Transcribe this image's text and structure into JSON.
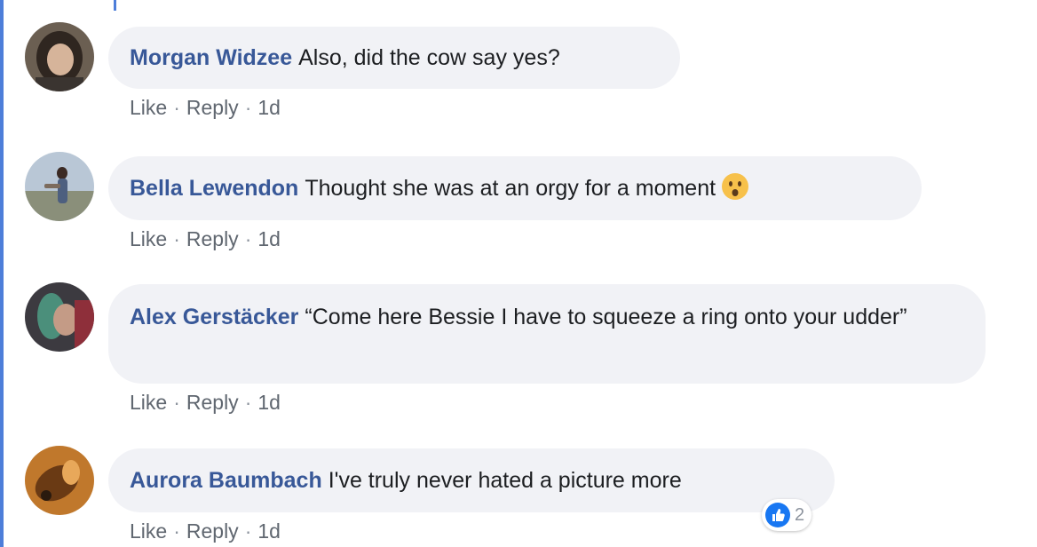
{
  "comments": [
    {
      "author": "Morgan Widzee",
      "text": "Also, did the cow say yes?",
      "actions": {
        "like": "Like",
        "reply": "Reply",
        "time": "1d"
      },
      "avatar_icon": "profile-photo-woman-dark-hair"
    },
    {
      "author": "Bella Lewendon",
      "text": "Thought she was at an orgy for a moment",
      "emoji": "astonished-face-emoji",
      "actions": {
        "like": "Like",
        "reply": "Reply",
        "time": "1d"
      },
      "avatar_icon": "profile-photo-standing-figure-outdoors"
    },
    {
      "author": "Alex Gerstäcker",
      "text": "“Come here Bessie I have to squeeze a ring onto your udder”",
      "actions": {
        "like": "Like",
        "reply": "Reply",
        "time": "1d"
      },
      "avatar_icon": "profile-photo-person-colorful-hair"
    },
    {
      "author": "Aurora Baumbach",
      "text": "I've truly never hated a picture more",
      "actions": {
        "like": "Like",
        "reply": "Reply",
        "time": "1d"
      },
      "reactions": {
        "icon": "like-thumb-icon",
        "count": "2"
      },
      "avatar_icon": "profile-photo-orange-abstract"
    }
  ],
  "separator": "·",
  "colors": {
    "author_link": "#385898",
    "bubble_bg": "#f1f2f6",
    "meta_text": "#606770",
    "thread_rule": "#4d7ed9",
    "like_blue": "#1877f2"
  }
}
